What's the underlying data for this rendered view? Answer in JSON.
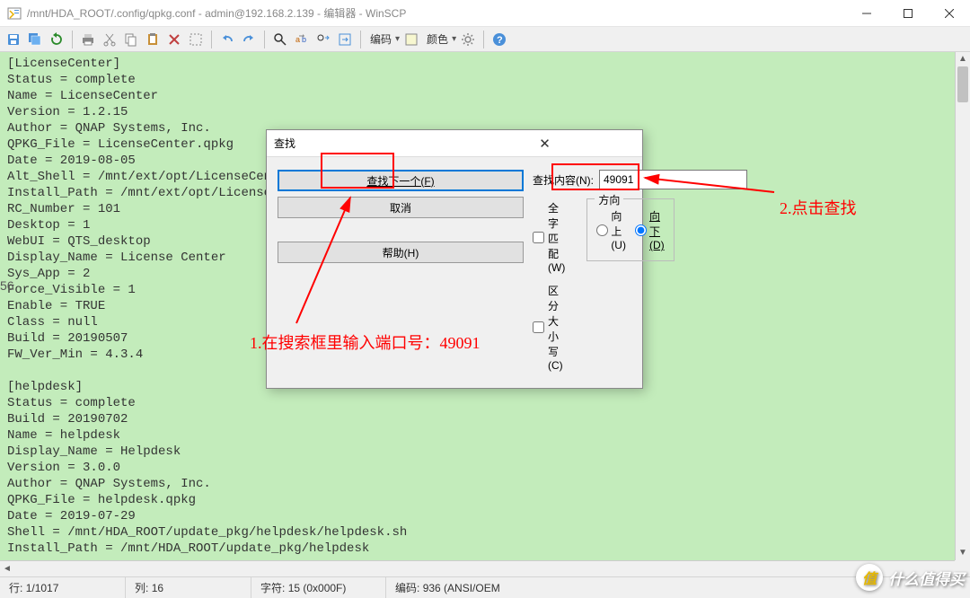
{
  "window": {
    "title": "/mnt/HDA_ROOT/.config/qpkg.conf - admin@192.168.2.139 - 编辑器 - WinSCP"
  },
  "toolbar": {
    "encoding_label": "编码",
    "color_label": "颜色"
  },
  "editor": {
    "content": "[LicenseCenter]\nStatus = complete\nName = LicenseCenter\nVersion = 1.2.15\nAuthor = QNAP Systems, Inc.\nQPKG_File = LicenseCenter.qpkg\nDate = 2019-08-05\nAlt_Shell = /mnt/ext/opt/LicenseCen\nInstall_Path = /mnt/ext/opt/License\nRC_Number = 101\nDesktop = 1\nWebUI = QTS_desktop\nDisplay_Name = License Center\nSys_App = 2\nForce_Visible = 1\nEnable = TRUE\nClass = null\nBuild = 20190507\nFW_Ver_Min = 4.3.4\n\n[helpdesk]\nStatus = complete\nBuild = 20190702\nName = helpdesk\nDisplay_Name = Helpdesk\nVersion = 3.0.0\nAuthor = QNAP Systems, Inc.\nQPKG_File = helpdesk.qpkg\nDate = 2019-07-29\nShell = /mnt/HDA_ROOT/update_pkg/helpdesk/helpdesk.sh\nInstall_Path = /mnt/HDA_ROOT/update_pkg/helpdesk"
  },
  "find": {
    "title": "查找",
    "label": "查找内容(N):",
    "value": "49091",
    "whole_word": "全字匹配(W)",
    "match_case": "区分大小写(C)",
    "direction_legend": "方向",
    "up": "向上(U)",
    "down": "向下(D)",
    "find_next": "查找下一个(F)",
    "cancel": "取消",
    "help": "帮助(H)"
  },
  "statusbar": {
    "line_label": "行:",
    "line_value": "1/1017",
    "col_label": "列:",
    "col_value": "16",
    "char_label": "字符:",
    "char_value": "15 (0x000F)",
    "enc_label": "编码:",
    "enc_value": "936  (ANSI/OEM"
  },
  "annotations": {
    "note1": "1.在搜索框里输入端口号：49091",
    "note2": "2.点击查找"
  },
  "watermark": {
    "text": "什么值得买"
  },
  "left_marker": "56"
}
